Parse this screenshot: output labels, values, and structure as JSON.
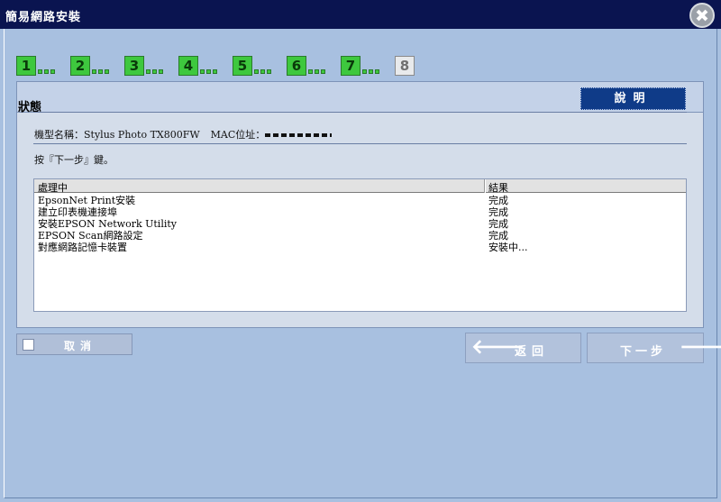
{
  "window": {
    "title": "簡易網路安裝"
  },
  "steps": [
    {
      "number": "1",
      "state": "done"
    },
    {
      "number": "2",
      "state": "done"
    },
    {
      "number": "3",
      "state": "done"
    },
    {
      "number": "4",
      "state": "done"
    },
    {
      "number": "5",
      "state": "done"
    },
    {
      "number": "6",
      "state": "done"
    },
    {
      "number": "7",
      "state": "done"
    },
    {
      "number": "8",
      "state": "current"
    }
  ],
  "panel": {
    "title": "狀態",
    "help_label": "說明",
    "model_label": "機型名稱：",
    "model_value": "Stylus Photo TX800FW",
    "mac_label": "MAC位址："
  },
  "instruction": "按『下一步』鍵。",
  "table": {
    "columns": [
      "處理中",
      "結果"
    ],
    "rows": [
      {
        "task": "EpsonNet Print安裝",
        "result": "完成"
      },
      {
        "task": "建立印表機連接埠",
        "result": "完成"
      },
      {
        "task": "安裝EPSON Network Utility",
        "result": "完成"
      },
      {
        "task": "EPSON Scan網路設定",
        "result": "完成"
      },
      {
        "task": "對應網路記憶卡裝置",
        "result": "安裝中..."
      }
    ]
  },
  "buttons": {
    "cancel": "取消",
    "back": "返回",
    "next": "下一步"
  },
  "colors": {
    "titlebar": "#0a1450",
    "background": "#a8c0e0",
    "step_done": "#3ec83e",
    "help_button": "#0f3b88"
  }
}
